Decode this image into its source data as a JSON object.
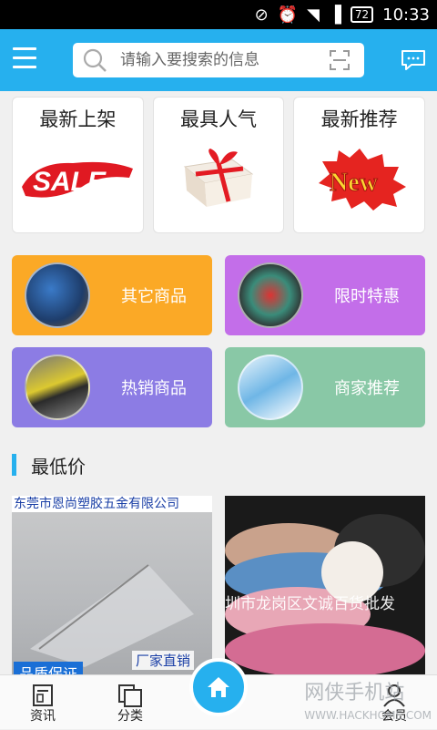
{
  "statusbar": {
    "time": "10:33",
    "battery": "72"
  },
  "search": {
    "placeholder": "请输入要搜索的信息"
  },
  "cards": [
    {
      "title": "最新上架",
      "image_text": "SALE"
    },
    {
      "title": "最具人气"
    },
    {
      "title": "最新推荐",
      "image_text": "New"
    }
  ],
  "tiles": [
    {
      "label": "其它商品",
      "color": "#fba926"
    },
    {
      "label": "限时特惠",
      "color": "#c36ee9"
    },
    {
      "label": "热销商品",
      "color": "#8c7ce4"
    },
    {
      "label": "商家推荐",
      "color": "#89c8a6"
    }
  ],
  "section": {
    "title": "最低价"
  },
  "products": [
    {
      "banner": "东莞市恩尚塑胶五金有限公司",
      "tag": "厂家直销",
      "tag2": "品质保证"
    },
    {
      "watermark": "圳市龙岗区文诚百货批发"
    }
  ],
  "tabs": [
    {
      "label": "资讯"
    },
    {
      "label": "分类"
    },
    {
      "label": "会员"
    }
  ],
  "watermark": {
    "main": "网侠手机站",
    "sub": "WWW.HACKHOME.COM"
  },
  "colors": {
    "brand": "#26b0ee"
  }
}
